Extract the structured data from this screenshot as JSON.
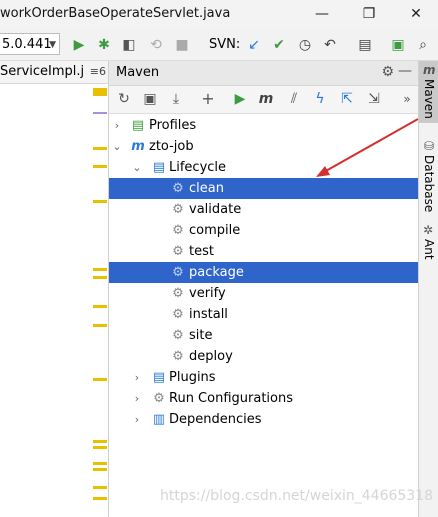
{
  "titlebar": {
    "title": "workOrderBaseOperateServlet.java"
  },
  "toolbar": {
    "version": "5.0.441",
    "svn_label": "SVN:"
  },
  "editor": {
    "tab_label": "ServiceImpl.j",
    "tab_more": "≡6"
  },
  "maven": {
    "title": "Maven",
    "tree": {
      "profiles": "Profiles",
      "project": "zto-job",
      "lifecycle": "Lifecycle",
      "phases": [
        "clean",
        "validate",
        "compile",
        "test",
        "package",
        "verify",
        "install",
        "site",
        "deploy"
      ],
      "plugins": "Plugins",
      "run_configs": "Run Configurations",
      "dependencies": "Dependencies"
    }
  },
  "side_tabs": {
    "maven": "Maven",
    "database": "Database",
    "ant": "Ant"
  },
  "watermark": "https://blog.csdn.net/weixin_44665318",
  "colors": {
    "selection": "#2f65ca",
    "accent_green": "#3e9c3e",
    "arrow": "#d32f2f"
  }
}
